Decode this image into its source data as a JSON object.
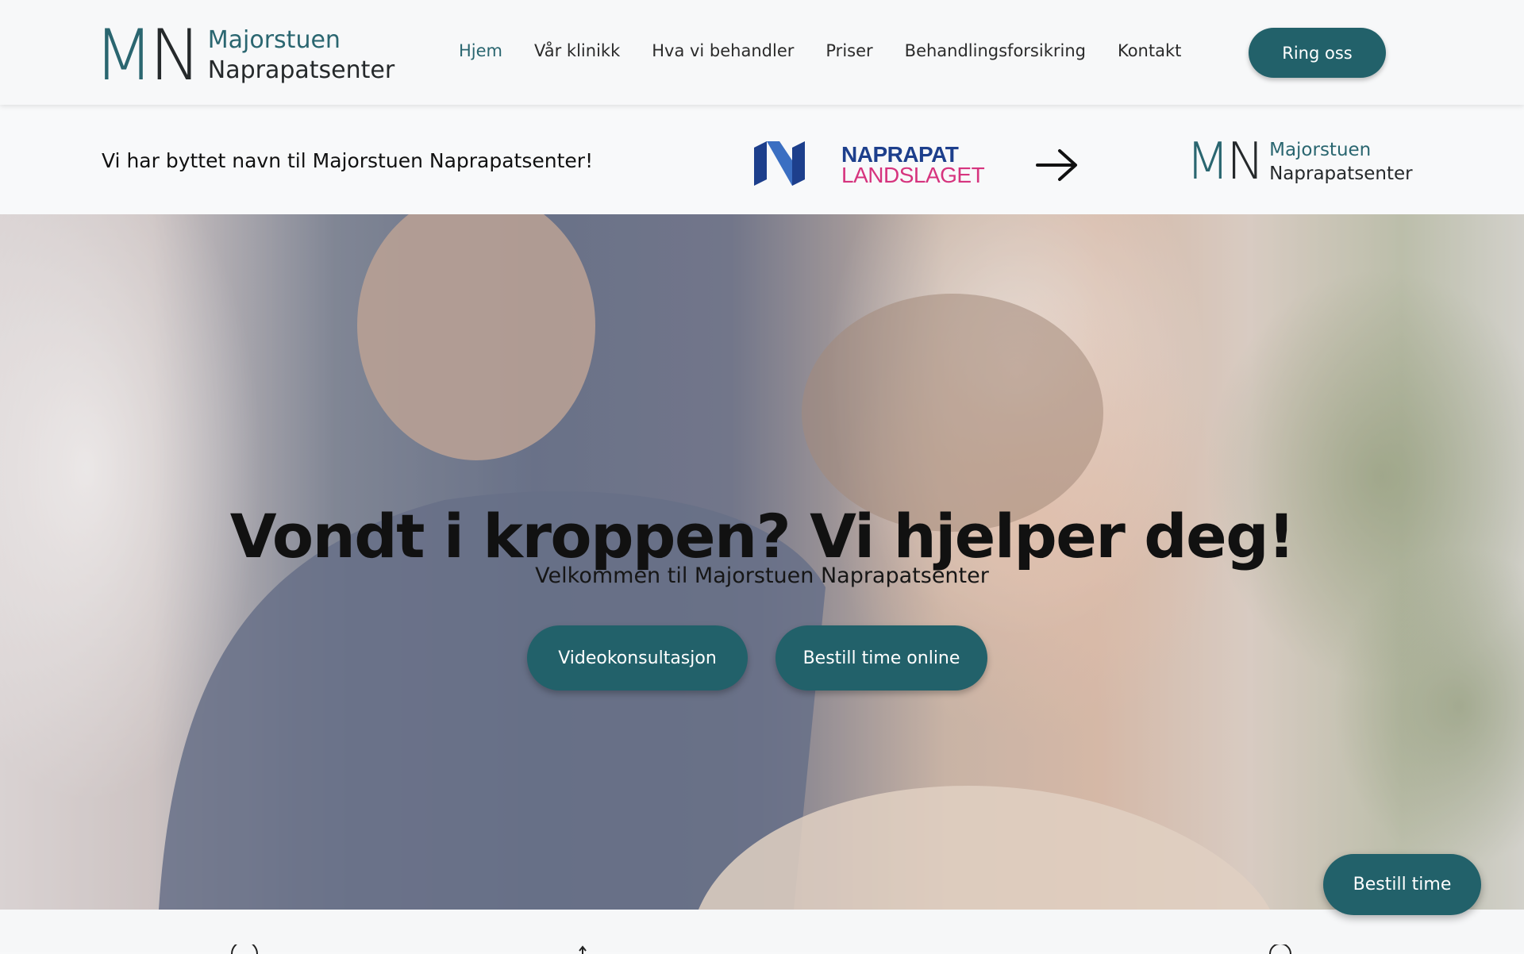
{
  "header": {
    "logo": {
      "mark_m": "M",
      "mark_n": "N",
      "line1": "Majorstuen",
      "line2": "Naprapatsenter"
    },
    "nav": [
      {
        "label": "Hjem",
        "active": true
      },
      {
        "label": "Vår klinikk",
        "active": false
      },
      {
        "label": "Hva vi behandler",
        "active": false
      },
      {
        "label": "Priser",
        "active": false
      },
      {
        "label": "Behandlingsforsikring",
        "active": false
      },
      {
        "label": "Kontakt",
        "active": false
      }
    ],
    "cta_label": "Ring oss"
  },
  "banner": {
    "text": "Vi har byttet navn til Majorstuen Naprapatsenter!",
    "old_brand": {
      "line1": "NAPRAPAT",
      "line2": "LANDSLAGET"
    },
    "new_brand": {
      "mark_m": "M",
      "mark_n": "N",
      "line1": "Majorstuen",
      "line2": "Naprapatsenter"
    }
  },
  "hero": {
    "title": "Vondt i kroppen? Vi hjelper deg!",
    "subtitle": "Velkommen til Majorstuen Naprapatsenter",
    "buttons": {
      "video": "Videokonsultasjon",
      "book": "Bestill time online"
    }
  },
  "floating_cta": "Bestill time",
  "colors": {
    "accent": "#22616a",
    "logo_teal": "#2a6670",
    "old_brand_blue": "#1d3f8c",
    "old_brand_pink": "#d6347e"
  },
  "icons": [
    "arrow-right-icon",
    "naprapat-landslaget-logo-icon"
  ]
}
